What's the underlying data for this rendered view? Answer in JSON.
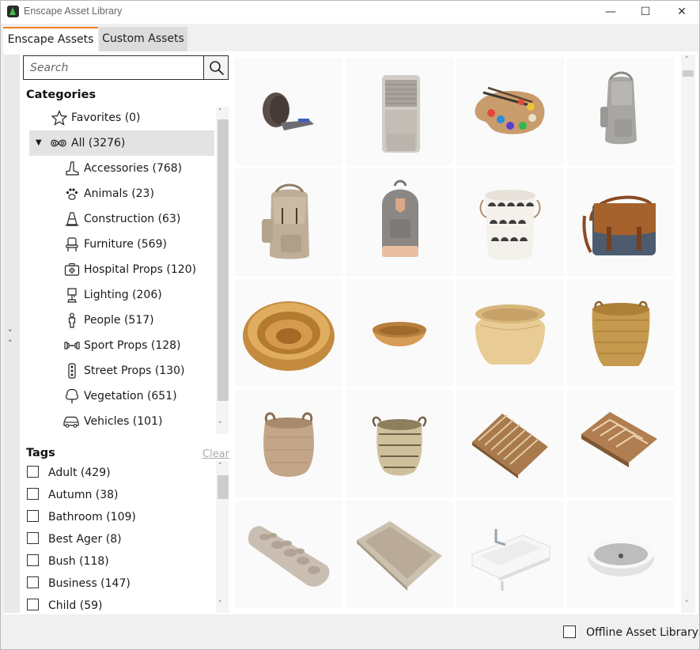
{
  "window": {
    "title": "Enscape Asset Library",
    "minimize_glyph": "—",
    "maximize_glyph": "☐",
    "close_glyph": "✕"
  },
  "tabs": [
    {
      "label": "Enscape Assets",
      "active": true
    },
    {
      "label": "Custom Assets",
      "active": false
    }
  ],
  "accent_color": "#f07f1a",
  "search": {
    "placeholder": "Search",
    "value": "",
    "icon": "magnifier-icon"
  },
  "categories": {
    "title": "Categories",
    "items": [
      {
        "label": "Favorites (0)",
        "icon": "star-icon"
      },
      {
        "label": "All (3276)",
        "icon": "infinity-icon",
        "selected": true,
        "expanded": true
      },
      {
        "label": "Accessories (768)",
        "icon": "boot-icon"
      },
      {
        "label": "Animals (23)",
        "icon": "paw-icon"
      },
      {
        "label": "Construction (63)",
        "icon": "traffic-cone-icon"
      },
      {
        "label": "Furniture (569)",
        "icon": "chair-icon"
      },
      {
        "label": "Hospital Props (120)",
        "icon": "medical-kit-icon"
      },
      {
        "label": "Lighting (206)",
        "icon": "lamp-icon"
      },
      {
        "label": "People (517)",
        "icon": "person-icon"
      },
      {
        "label": "Sport Props (128)",
        "icon": "dumbbell-icon"
      },
      {
        "label": "Street Props (130)",
        "icon": "traffic-light-icon"
      },
      {
        "label": "Vegetation (651)",
        "icon": "tree-icon"
      },
      {
        "label": "Vehicles (101)",
        "icon": "car-icon"
      }
    ]
  },
  "tags": {
    "title": "Tags",
    "clear_label": "Clear",
    "items": [
      {
        "label": "Adult (429)",
        "checked": false
      },
      {
        "label": "Autumn (38)",
        "checked": false
      },
      {
        "label": "Bathroom (109)",
        "checked": false
      },
      {
        "label": "Best Ager (8)",
        "checked": false
      },
      {
        "label": "Bush (118)",
        "checked": false
      },
      {
        "label": "Business (147)",
        "checked": false
      },
      {
        "label": "Child (59)",
        "checked": false
      }
    ]
  },
  "assets": [
    {
      "kind": "tape-measure"
    },
    {
      "kind": "air-cooler"
    },
    {
      "kind": "paint-palette"
    },
    {
      "kind": "backpack-grey"
    },
    {
      "kind": "backpack-canvas"
    },
    {
      "kind": "backpack-grey-leather"
    },
    {
      "kind": "laundry-basket"
    },
    {
      "kind": "messenger-bag"
    },
    {
      "kind": "wicker-bowl-round"
    },
    {
      "kind": "wicker-bowl-small"
    },
    {
      "kind": "belly-basket"
    },
    {
      "kind": "wicker-basket-tall"
    },
    {
      "kind": "woven-basket-handles"
    },
    {
      "kind": "woven-basket-striped"
    },
    {
      "kind": "bath-mat-slatted"
    },
    {
      "kind": "bath-mat-chevron"
    },
    {
      "kind": "bath-mat-pebble"
    },
    {
      "kind": "bath-mat-fabric"
    },
    {
      "kind": "washbasin-rect"
    },
    {
      "kind": "washbasin-oval"
    }
  ],
  "footer": {
    "offline_label": "Offline Asset Library",
    "offline_checked": false
  }
}
